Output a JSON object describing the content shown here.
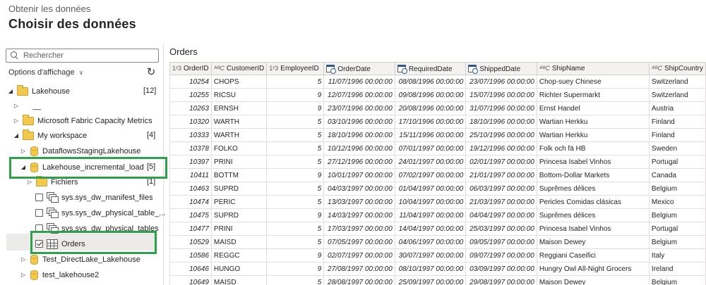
{
  "header": {
    "subtitle": "Obtenir les données",
    "title": "Choisir des données"
  },
  "left": {
    "search_placeholder": "Rechercher",
    "options_label": "Options d'affichage",
    "tree": [
      {
        "label": "Lakehouse",
        "count": "[12]"
      },
      {
        "label": "__",
        "count": ""
      },
      {
        "label": "Microsoft Fabric Capacity Metrics",
        "count": ""
      },
      {
        "label": "My workspace",
        "count": "[4]"
      },
      {
        "label": "DataflowsStagingLakehouse",
        "count": ""
      },
      {
        "label": "Lakehouse_incremental_load",
        "count": "[5]"
      },
      {
        "label": "Fichiers",
        "count": "[1]"
      },
      {
        "label": "sys.sys_dw_manifest_files",
        "count": ""
      },
      {
        "label": "sys.sys_dw_physical_table_...",
        "count": ""
      },
      {
        "label": "sys.sys_dw_physical_tables",
        "count": ""
      },
      {
        "label": "Orders",
        "count": ""
      },
      {
        "label": "Test_DirectLake_Lakehouse",
        "count": ""
      },
      {
        "label": "test_lakehouse2",
        "count": ""
      }
    ]
  },
  "preview": {
    "title": "Orders",
    "columns": [
      {
        "name": "OrderID",
        "type": "123"
      },
      {
        "name": "CustomerID",
        "type": "ABC"
      },
      {
        "name": "EmployeeID",
        "type": "123"
      },
      {
        "name": "OrderDate",
        "type": "date"
      },
      {
        "name": "RequiredDate",
        "type": "date"
      },
      {
        "name": "ShippedDate",
        "type": "date"
      },
      {
        "name": "ShipName",
        "type": "ABC"
      },
      {
        "name": "ShipCountry",
        "type": "ABC"
      }
    ],
    "rows": [
      [
        "10254",
        "CHOPS",
        "5",
        "11/07/1996 00:00:00",
        "08/08/1996 00:00:00",
        "23/07/1996 00:00:00",
        "Chop-suey Chinese",
        "Switzerland"
      ],
      [
        "10255",
        "RICSU",
        "9",
        "12/07/1996 00:00:00",
        "09/08/1996 00:00:00",
        "15/07/1996 00:00:00",
        "Richter Supermarkt",
        "Switzerland"
      ],
      [
        "10263",
        "ERNSH",
        "9",
        "23/07/1996 00:00:00",
        "20/08/1996 00:00:00",
        "31/07/1996 00:00:00",
        "Ernst Handel",
        "Austria"
      ],
      [
        "10320",
        "WARTH",
        "5",
        "03/10/1996 00:00:00",
        "17/10/1996 00:00:00",
        "18/10/1996 00:00:00",
        "Wartian Herkku",
        "Finland"
      ],
      [
        "10333",
        "WARTH",
        "5",
        "18/10/1996 00:00:00",
        "15/11/1996 00:00:00",
        "25/10/1996 00:00:00",
        "Wartian Herkku",
        "Finland"
      ],
      [
        "10378",
        "FOLKO",
        "5",
        "10/12/1996 00:00:00",
        "07/01/1997 00:00:00",
        "19/12/1996 00:00:00",
        "Folk och fä HB",
        "Sweden"
      ],
      [
        "10397",
        "PRINI",
        "5",
        "27/12/1996 00:00:00",
        "24/01/1997 00:00:00",
        "02/01/1997 00:00:00",
        "Princesa Isabel Vinhos",
        "Portugal"
      ],
      [
        "10411",
        "BOTTM",
        "9",
        "10/01/1997 00:00:00",
        "07/02/1997 00:00:00",
        "21/01/1997 00:00:00",
        "Bottom-Dollar Markets",
        "Canada"
      ],
      [
        "10463",
        "SUPRD",
        "5",
        "04/03/1997 00:00:00",
        "01/04/1997 00:00:00",
        "06/03/1997 00:00:00",
        "Suprêmes délices",
        "Belgium"
      ],
      [
        "10474",
        "PERIC",
        "5",
        "13/03/1997 00:00:00",
        "10/04/1997 00:00:00",
        "21/03/1997 00:00:00",
        "Pericles Comidas clásicas",
        "Mexico"
      ],
      [
        "10475",
        "SUPRD",
        "9",
        "14/03/1997 00:00:00",
        "11/04/1997 00:00:00",
        "04/04/1997 00:00:00",
        "Suprêmes délices",
        "Belgium"
      ],
      [
        "10477",
        "PRINI",
        "5",
        "17/03/1997 00:00:00",
        "14/04/1997 00:00:00",
        "25/03/1997 00:00:00",
        "Princesa Isabel Vinhos",
        "Portugal"
      ],
      [
        "10529",
        "MAISD",
        "5",
        "07/05/1997 00:00:00",
        "04/06/1997 00:00:00",
        "09/05/1997 00:00:00",
        "Maison Dewey",
        "Belgium"
      ],
      [
        "10586",
        "REGGC",
        "9",
        "02/07/1997 00:00:00",
        "30/07/1997 00:00:00",
        "09/07/1997 00:00:00",
        "Reggiani Caseifici",
        "Italy"
      ],
      [
        "10646",
        "HUNGO",
        "9",
        "27/08/1997 00:00:00",
        "08/10/1997 00:00:00",
        "03/09/1997 00:00:00",
        "Hungry Owl All-Night Grocers",
        "Ireland"
      ],
      [
        "10649",
        "MAISD",
        "5",
        "28/08/1997 00:00:00",
        "25/09/1997 00:00:00",
        "29/08/1997 00:00:00",
        "Maison Dewey",
        "Belgium"
      ]
    ]
  },
  "colors": {
    "highlight": "#2ca34a",
    "folder": "#f2c94c"
  }
}
